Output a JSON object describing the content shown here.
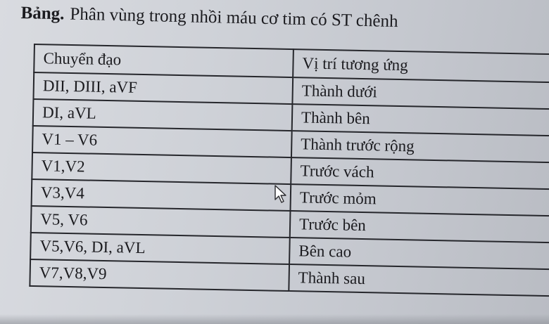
{
  "title": {
    "lead": "Bảng.",
    "text": "Phân vùng trong nhồi máu cơ tim có ST chênh"
  },
  "table": {
    "headers": [
      "Chuyển đạo",
      "Vị trí tương ứng"
    ],
    "rows": [
      [
        "DII, DIII, aVF",
        "Thành dưới"
      ],
      [
        "DI, aVL",
        "Thành bên"
      ],
      [
        "V1 – V6",
        "Thành trước rộng"
      ],
      [
        "V1,V2",
        "Trước vách"
      ],
      [
        "V3,V4",
        "Trước mỏm"
      ],
      [
        "V5, V6",
        "Trước bên"
      ],
      [
        "V5,V6, DI, aVL",
        "Bên cao"
      ],
      [
        "V7,V8,V9",
        "Thành sau"
      ]
    ]
  },
  "colors": {
    "text": "#1b1b1f",
    "border": "#26272c",
    "background": "#cfd2d8"
  },
  "icons": [
    "mouse-pointer-icon"
  ]
}
